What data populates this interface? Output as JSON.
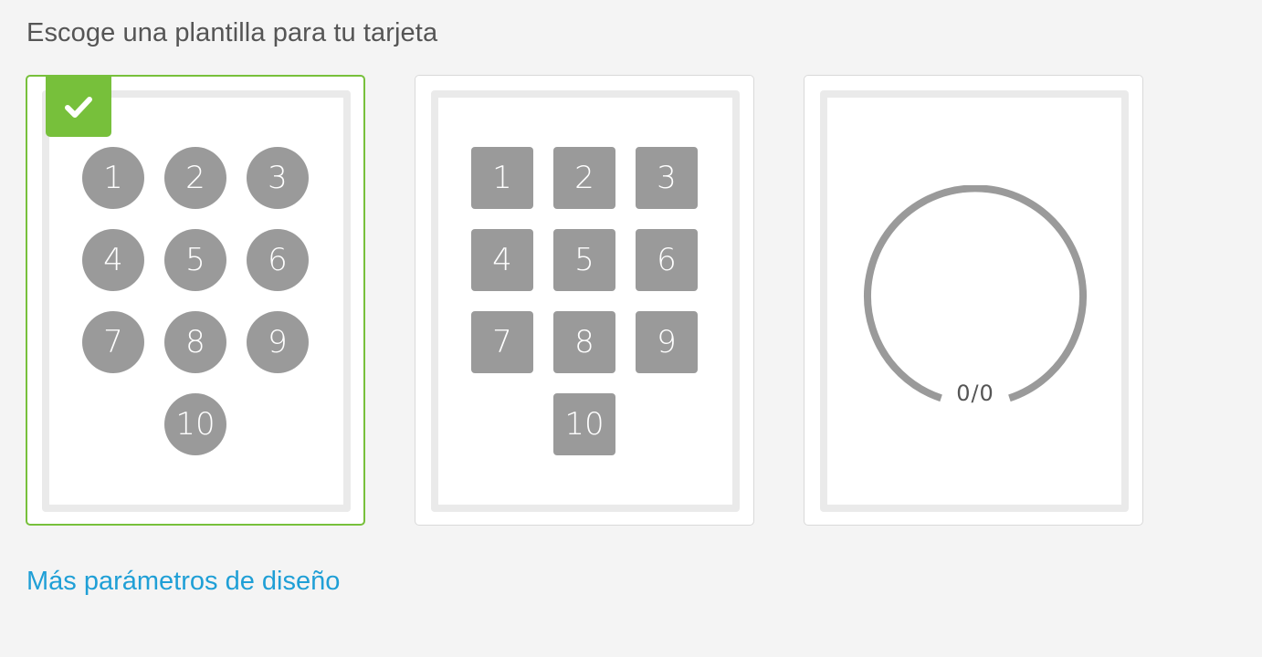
{
  "heading": "Escoge una plantilla para tu tarjeta",
  "templates": [
    {
      "id": "circles",
      "style": "circle",
      "selected": true,
      "stamps": [
        "1",
        "2",
        "3",
        "4",
        "5",
        "6",
        "7",
        "8",
        "9",
        "10"
      ]
    },
    {
      "id": "squares",
      "style": "square",
      "selected": false,
      "stamps": [
        "1",
        "2",
        "3",
        "4",
        "5",
        "6",
        "7",
        "8",
        "9",
        "10"
      ]
    },
    {
      "id": "progress",
      "style": "progress-ring",
      "selected": false,
      "progress_label": "0/0",
      "progress_value": 0
    }
  ],
  "more_link": "Más parámetros de diseño",
  "icons": {
    "selected_badge": "check-icon"
  },
  "colors": {
    "selected_accent": "#77c03b",
    "link": "#1f9fd6",
    "stamp_fill": "#9a9a9a",
    "frame": "#eaeaea"
  }
}
